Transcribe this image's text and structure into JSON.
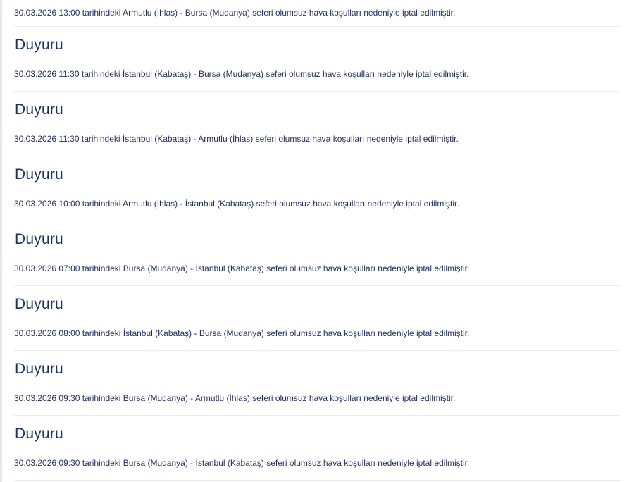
{
  "feed": {
    "first_text": "30.03.2026 13:00 tarihindeki Armutlu (İhlas) - Bursa (Mudanya) seferi olumsuz hava koşulları nedeniyle iptal edilmiştir.",
    "items": [
      {
        "title": "Duyuru",
        "text": "30.03.2026 11:30 tarihindeki İstanbul (Kabataş) - Bursa (Mudanya) seferi olumsuz hava koşulları nedeniyle iptal edilmiştir."
      },
      {
        "title": "Duyuru",
        "text": "30.03.2026 11:30 tarihindeki İstanbul (Kabataş) - Armutlu (İhlas) seferi olumsuz hava koşulları nedeniyle iptal edilmiştir."
      },
      {
        "title": "Duyuru",
        "text": "30.03.2026 10:00 tarihindeki Armutlu (İhlas) - İstanbul (Kabataş) seferi olumsuz hava koşulları nedeniyle iptal edilmiştir."
      },
      {
        "title": "Duyuru",
        "text": "30.03.2026 07:00 tarihindeki Bursa (Mudanya) - İstanbul (Kabataş) seferi olumsuz hava koşulları nedeniyle iptal edilmiştir."
      },
      {
        "title": "Duyuru",
        "text": "30.03.2026 08:00 tarihindeki İstanbul (Kabataş) - Bursa (Mudanya) seferi olumsuz hava koşulları nedeniyle iptal edilmiştir."
      },
      {
        "title": "Duyuru",
        "text": "30.03.2026 09:30 tarihindeki Bursa (Mudanya) - Armutlu (İhlas) seferi olumsuz hava koşulları nedeniyle iptal edilmiştir."
      },
      {
        "title": "Duyuru",
        "text": "30.03.2026 09:30 tarihindeki Bursa (Mudanya) - İstanbul (Kabataş) seferi olumsuz hava koşulları nedeniyle iptal edilmiştir."
      }
    ]
  },
  "colors": {
    "title": "#1d3263",
    "text": "#1f2f5c",
    "divider": "#e9ebef"
  }
}
